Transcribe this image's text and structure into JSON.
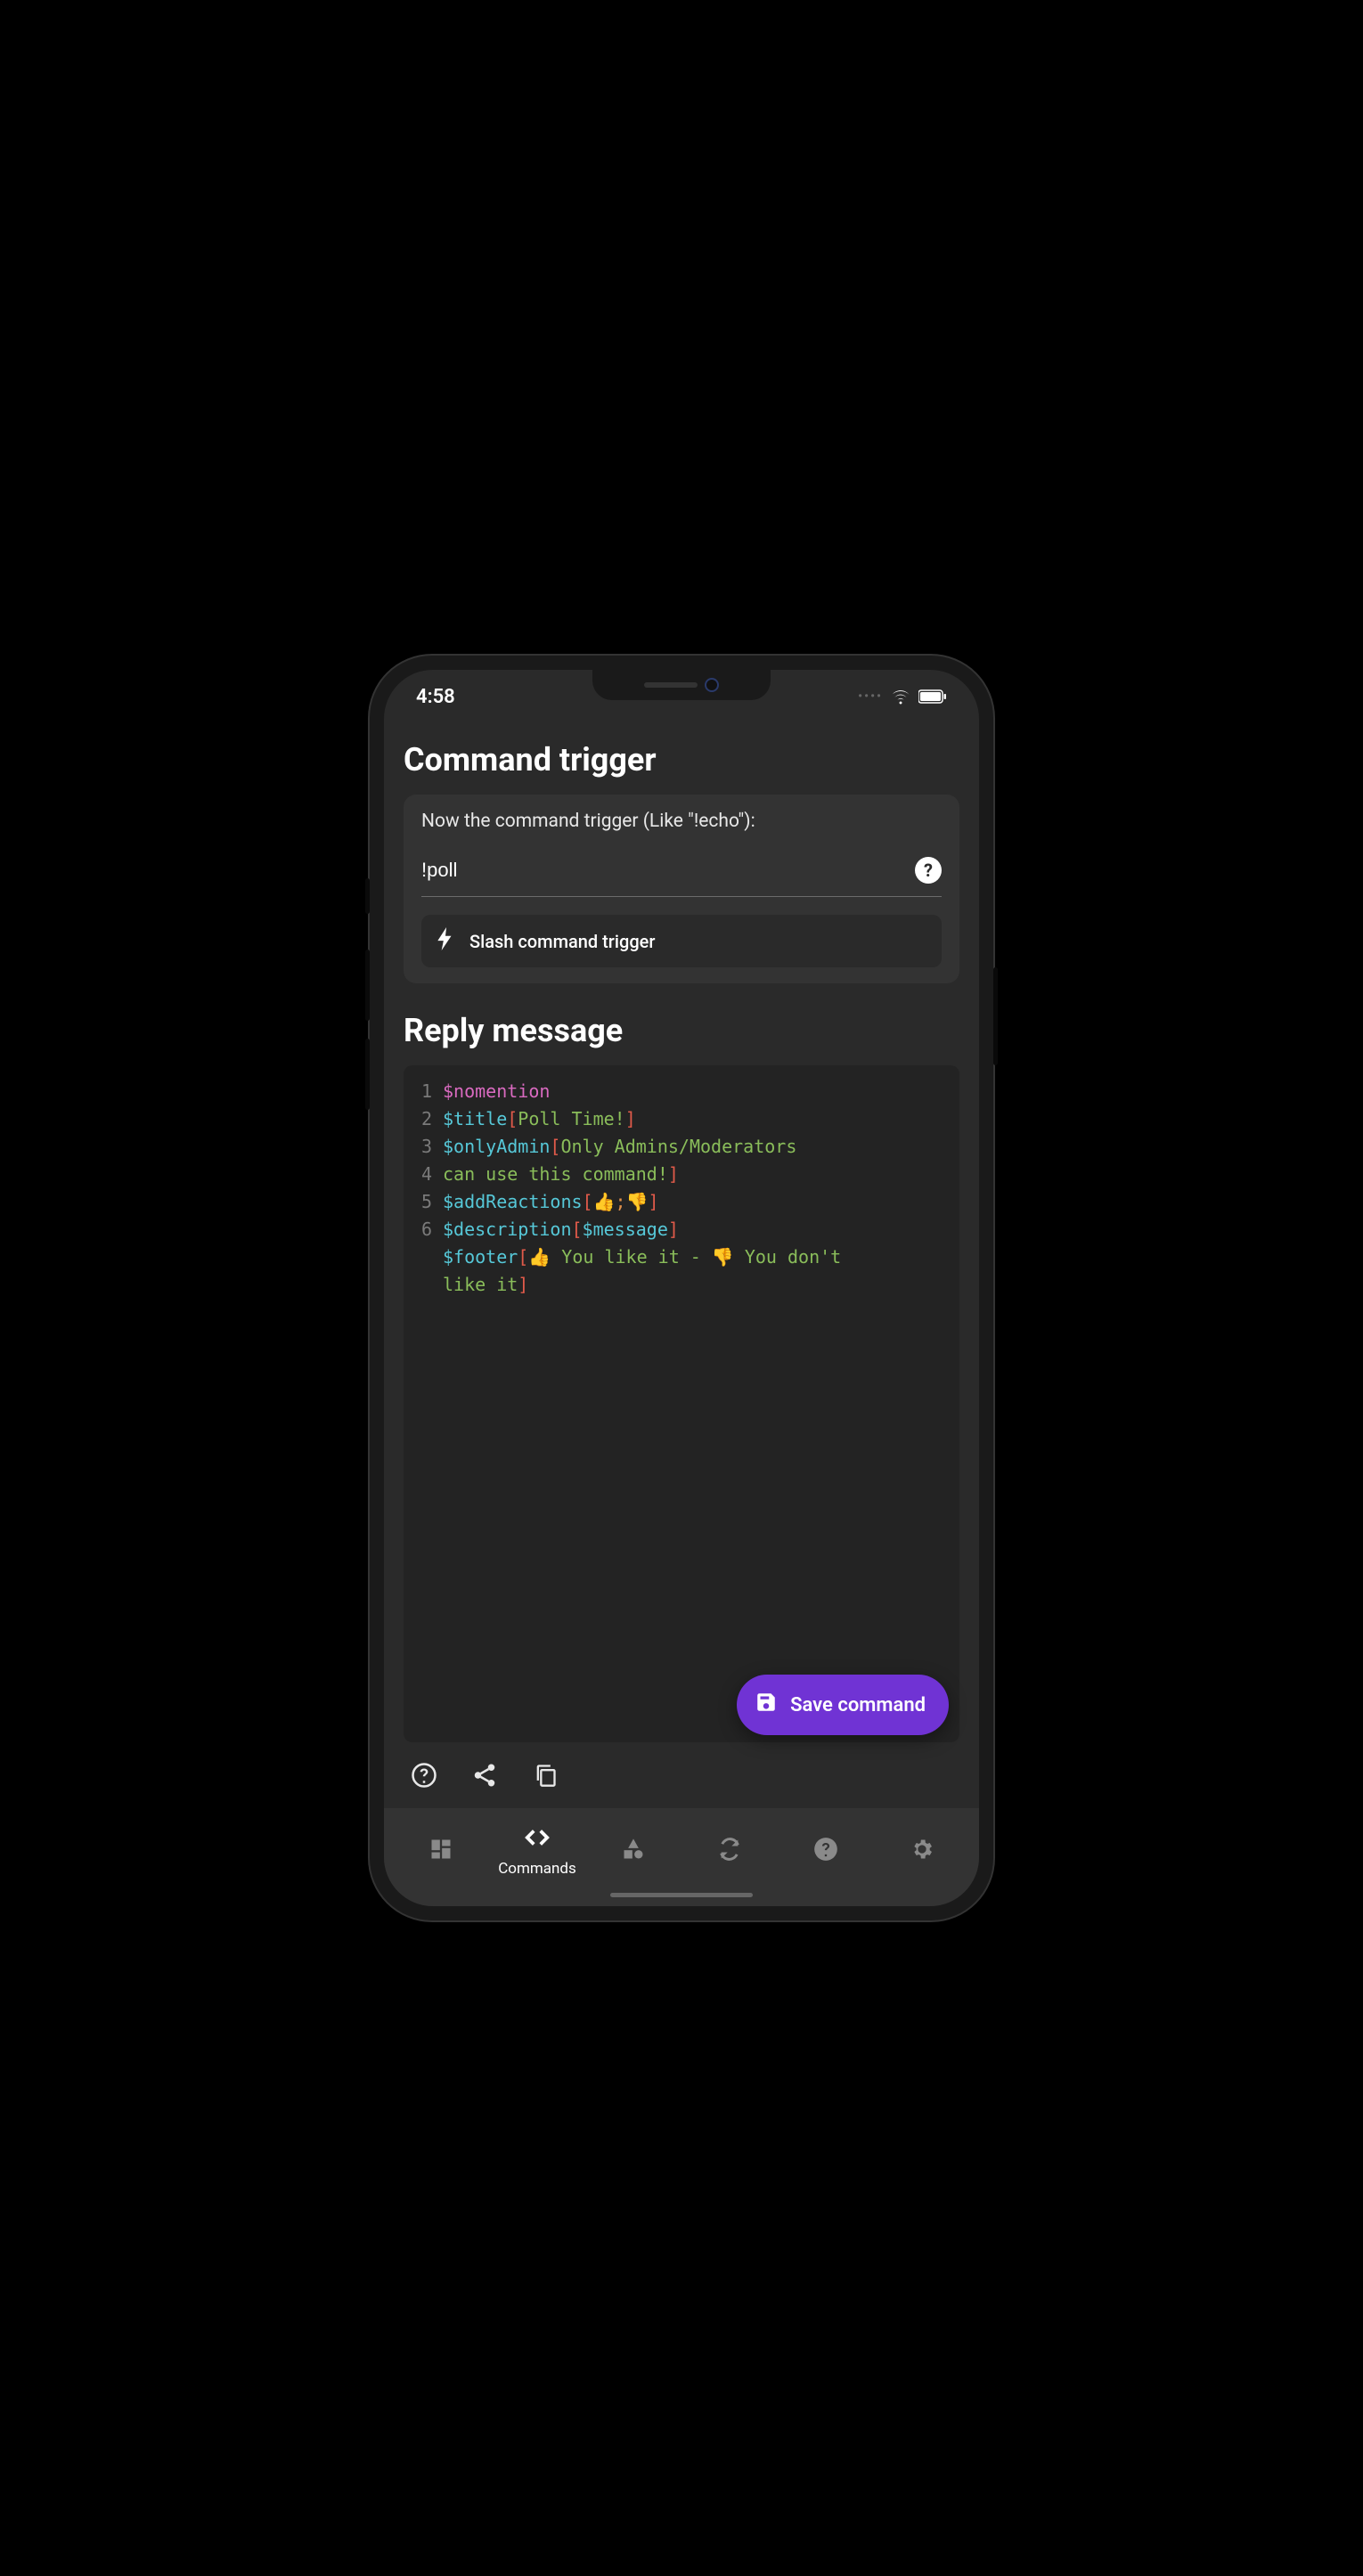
{
  "status": {
    "time": "4:58"
  },
  "section1": {
    "title": "Command trigger",
    "label": "Now the command trigger (Like \"!echo\"):",
    "value": "!poll",
    "slash_label": "Slash command trigger"
  },
  "section2": {
    "title": "Reply message",
    "code": [
      {
        "n": "1",
        "tokens": [
          {
            "t": "$nomention",
            "c": "pink"
          }
        ]
      },
      {
        "n": "2",
        "tokens": [
          {
            "t": "$title",
            "c": "cyan"
          },
          {
            "t": "[",
            "c": "red"
          },
          {
            "t": "Poll Time!",
            "c": "green"
          },
          {
            "t": "]",
            "c": "red"
          }
        ]
      },
      {
        "n": "3",
        "tokens": [
          {
            "t": "$onlyAdmin",
            "c": "cyan"
          },
          {
            "t": "[",
            "c": "red"
          },
          {
            "t": "Only Admins/Moderators",
            "c": "green"
          }
        ]
      },
      {
        "n": "4",
        "tokens": [
          {
            "t": "can use this command!",
            "c": "green"
          },
          {
            "t": "]",
            "c": "red"
          }
        ]
      },
      {
        "n": "5",
        "tokens": [
          {
            "t": "$addReactions",
            "c": "cyan"
          },
          {
            "t": "[",
            "c": "red"
          },
          {
            "t": "👍",
            "c": ""
          },
          {
            "t": ";",
            "c": "orange"
          },
          {
            "t": "👎",
            "c": ""
          },
          {
            "t": "]",
            "c": "red"
          }
        ]
      },
      {
        "n": "6",
        "tokens": [
          {
            "t": "$description",
            "c": "cyan"
          },
          {
            "t": "[",
            "c": "red"
          },
          {
            "t": "$message",
            "c": "cyan"
          },
          {
            "t": "]",
            "c": "red"
          }
        ]
      },
      {
        "n": "",
        "tokens": [
          {
            "t": "$footer",
            "c": "cyan"
          },
          {
            "t": "[",
            "c": "red"
          },
          {
            "t": "👍 ",
            "c": ""
          },
          {
            "t": "You like it - ",
            "c": "green"
          },
          {
            "t": "👎 ",
            "c": ""
          },
          {
            "t": "You don't",
            "c": "green"
          }
        ]
      },
      {
        "n": "",
        "tokens": [
          {
            "t": "like it",
            "c": "green"
          },
          {
            "t": "]",
            "c": "red"
          }
        ]
      }
    ]
  },
  "fab": {
    "label": "Save command"
  },
  "nav": {
    "items": [
      {
        "label": "",
        "icon": "dashboard"
      },
      {
        "label": "Commands",
        "icon": "code",
        "active": true
      },
      {
        "label": "",
        "icon": "shapes"
      },
      {
        "label": "",
        "icon": "sync"
      },
      {
        "label": "",
        "icon": "help"
      },
      {
        "label": "",
        "icon": "gear"
      }
    ]
  }
}
